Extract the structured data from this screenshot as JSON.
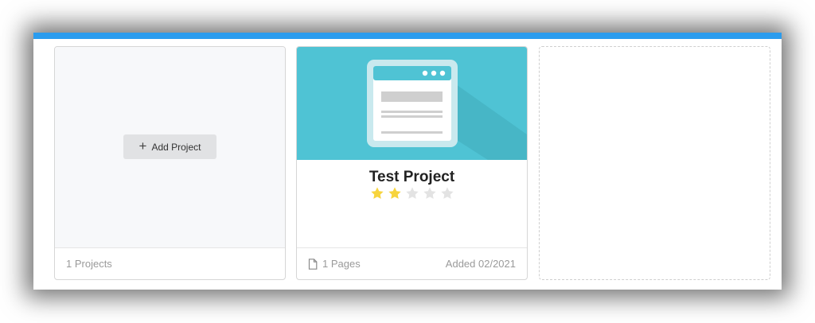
{
  "add_card": {
    "button_label": "Add Project",
    "footer_count": "1 Projects"
  },
  "project": {
    "title": "Test Project",
    "rating": 2,
    "rating_max": 5,
    "pages": "1 Pages",
    "added": "Added 02/2021"
  },
  "colors": {
    "accent_bar": "#2b9cee",
    "thumbnail_bg": "#4fc3d4",
    "star_filled": "#f7d43d",
    "star_empty": "#e3e3e3"
  }
}
